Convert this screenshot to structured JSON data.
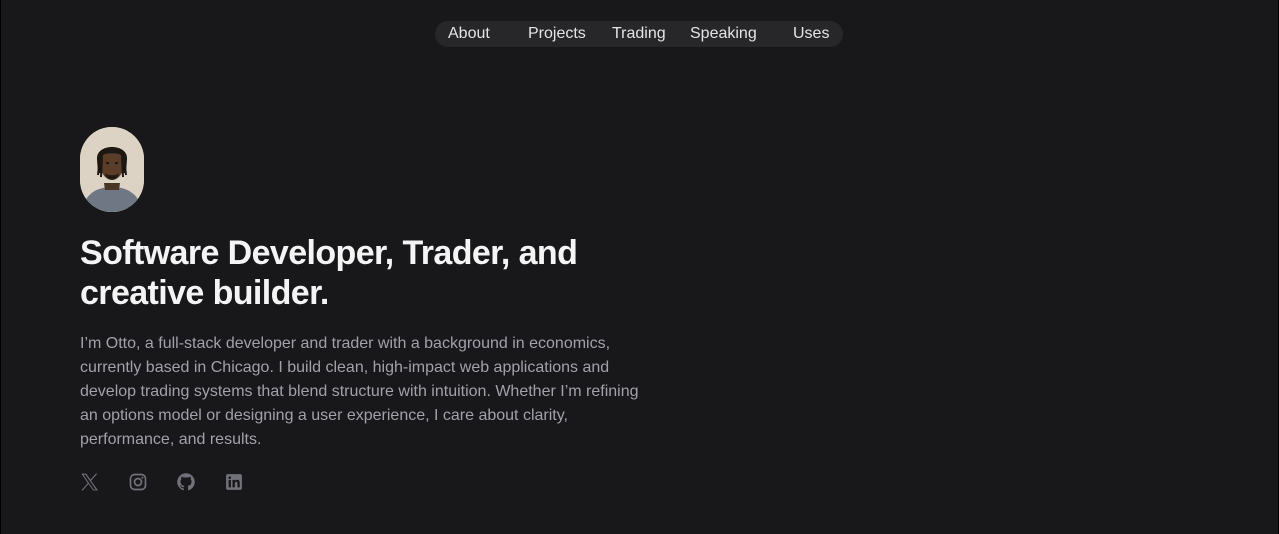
{
  "nav": {
    "items": [
      {
        "label": "About"
      },
      {
        "label": "Projects"
      },
      {
        "label": "Trading"
      },
      {
        "label": "Speaking"
      },
      {
        "label": "Uses"
      }
    ]
  },
  "hero": {
    "headline_line1": "Software Developer, Trader, and",
    "headline_line2": "creative builder.",
    "bio": "I’m Otto, a full-stack developer and trader with a background in economics, currently based in Chicago. I build clean, high-impact web applications and develop trading systems that blend structure with intuition. Whether I’m refining an options model or designing a user experience, I care about clarity, performance, and results."
  },
  "socials": [
    {
      "icon": "x-icon"
    },
    {
      "icon": "instagram-icon"
    },
    {
      "icon": "github-icon"
    },
    {
      "icon": "linkedin-icon"
    }
  ],
  "colors": {
    "background": "#18181b",
    "nav_background": "#27272a",
    "headline": "#f4f4f5",
    "body_text": "#a1a1aa",
    "icon": "#71717a"
  }
}
